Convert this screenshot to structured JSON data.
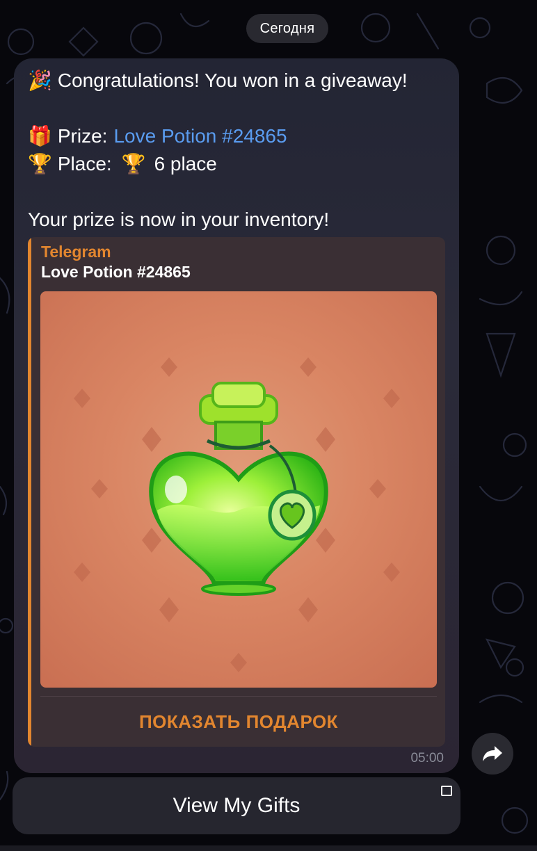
{
  "date_divider": "Сегодня",
  "message": {
    "line1_text": "Congratulations! You won in a giveaway!",
    "prize_label": "Prize:",
    "prize_link": "Love Potion #24865",
    "place_label": "Place:",
    "place_value": "6 place",
    "inventory_text": "Your prize is now in your inventory!",
    "time": "05:00"
  },
  "icons": {
    "line1": "party-popper-icon",
    "prize": "gift-icon",
    "place": "trophy-icon",
    "share": "share-arrow-icon"
  },
  "emoji": {
    "party": "🎉",
    "gift": "🎁",
    "trophy": "🏆"
  },
  "preview": {
    "site_name": "Telegram",
    "title": "Love Potion #24865",
    "action_label": "ПОКАЗАТЬ ПОДАРОК"
  },
  "keyboard": {
    "button_label": "View My Gifts"
  },
  "colors": {
    "accent_orange": "#e2862f",
    "link_blue": "#5a9cf0",
    "bubble": "#272837",
    "gift_background": "#d98563",
    "potion_green": "#7ee02c"
  }
}
